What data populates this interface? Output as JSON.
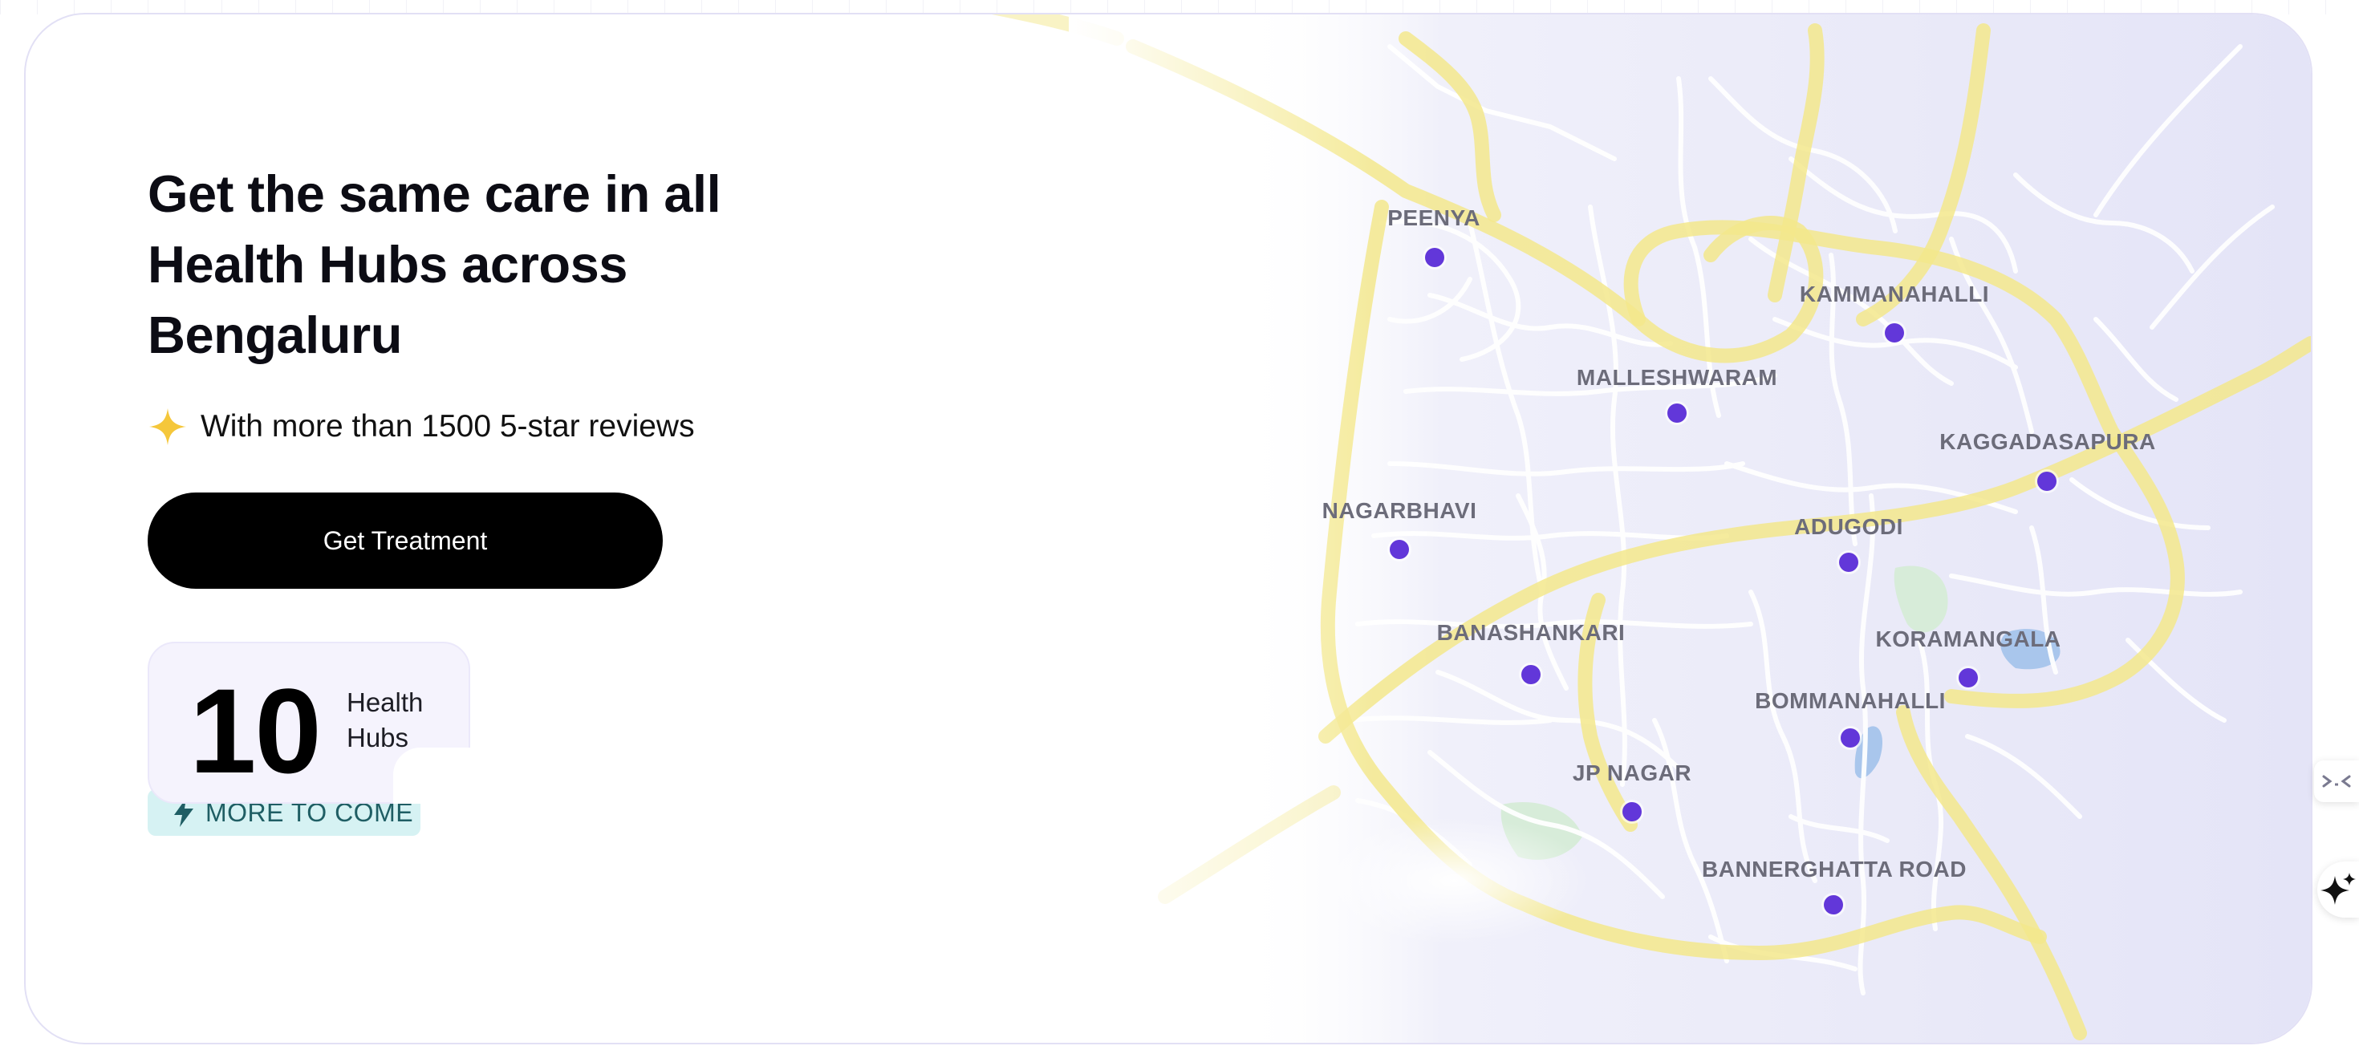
{
  "hero": {
    "headline_lines": [
      "Get the same care in all",
      "Health Hubs across",
      "Bengaluru"
    ],
    "reviews_text": "With more than 1500 5-star reviews",
    "cta_label": "Get Treatment",
    "stat": {
      "value": "10",
      "label_line1": "Health",
      "label_line2": "Hubs"
    },
    "badge_label": "MORE TO COME"
  },
  "map": {
    "locations": [
      {
        "name": "PEENYA"
      },
      {
        "name": "KAMMANAHALLI"
      },
      {
        "name": "MALLESHWARAM"
      },
      {
        "name": "KAGGADASAPURA"
      },
      {
        "name": "NAGARBHAVI"
      },
      {
        "name": "ADUGODI"
      },
      {
        "name": "BANASHANKARI"
      },
      {
        "name": "KORAMANGALA"
      },
      {
        "name": "BOMMANAHALLI"
      },
      {
        "name": "JP NAGAR"
      },
      {
        "name": "BANNERGHATTA ROAD"
      }
    ]
  },
  "colors": {
    "accent_dot": "#6237d9",
    "ring_road": "#f3e78c",
    "badge_bg": "#d6f2f3",
    "star": "#f5c73b"
  },
  "icons": [
    "sparkle-star-icon",
    "lightning-bolt-icon",
    "collapse-icon",
    "ai-sparkle-icon"
  ]
}
